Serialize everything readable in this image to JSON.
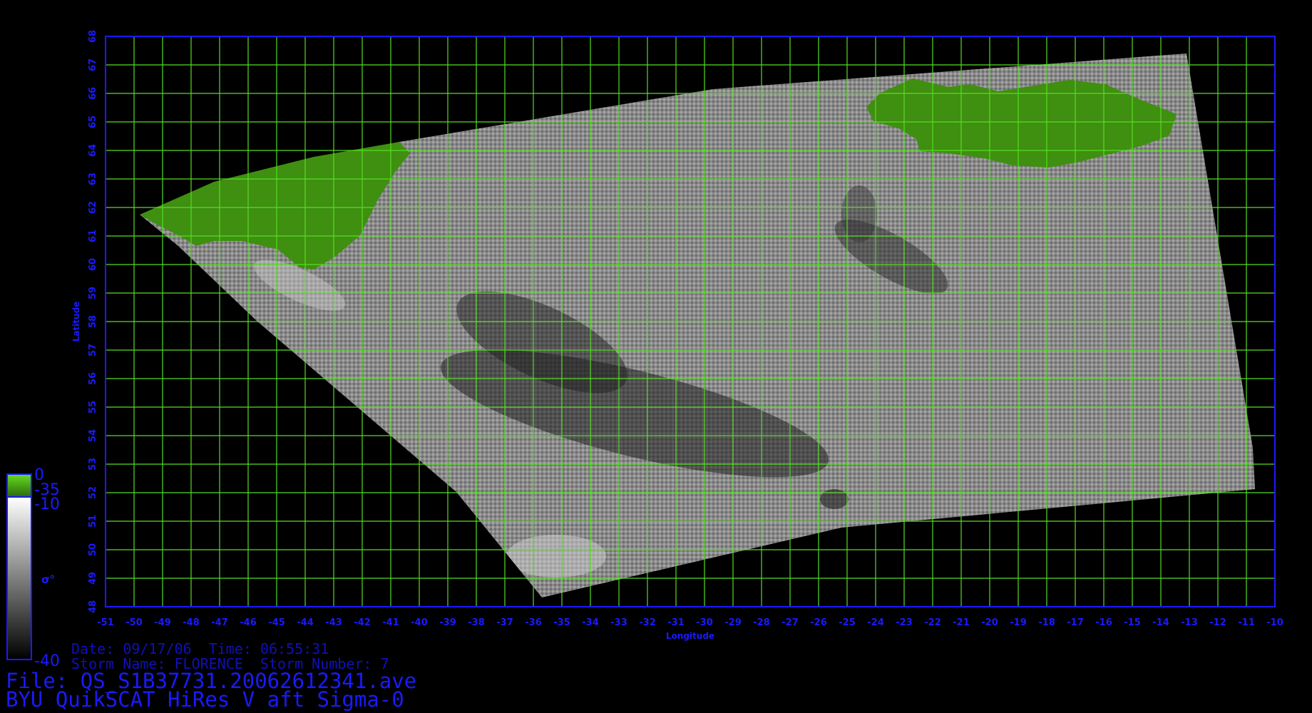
{
  "map": {
    "x_label": "Longitude",
    "y_label": "Latitude",
    "lon_range": [
      -51,
      -10
    ],
    "lat_range": [
      48,
      68
    ],
    "lon_ticks": [
      "-51",
      "-50",
      "-49",
      "-48",
      "-47",
      "-46",
      "-45",
      "-44",
      "-43",
      "-42",
      "-41",
      "-40",
      "-39",
      "-38",
      "-37",
      "-36",
      "-35",
      "-34",
      "-33",
      "-32",
      "-31",
      "-30",
      "-29",
      "-28",
      "-27",
      "-26",
      "-25",
      "-24",
      "-23",
      "-22",
      "-21",
      "-20",
      "-19",
      "-18",
      "-17",
      "-16",
      "-15",
      "-14",
      "-13",
      "-12",
      "-11",
      "-10"
    ],
    "lat_ticks": [
      "48",
      "49",
      "50",
      "51",
      "52",
      "53",
      "54",
      "55",
      "56",
      "57",
      "58",
      "59",
      "60",
      "61",
      "62",
      "63",
      "64",
      "65",
      "66",
      "67",
      "68"
    ],
    "grid_color": "#55dd22",
    "frame_color": "#1a1aff",
    "land_color": "#3f8f10",
    "grid": true
  },
  "colorbar": {
    "land_top": "0",
    "land_bottom": "-35",
    "sigma_top": "-10",
    "sigma_bottom": "-40",
    "symbol": "σ°"
  },
  "info": {
    "date_line": "Date: 09/17/06  Time: 06:55:31",
    "storm_line": "Storm Name: FLORENCE  Storm Number: 7",
    "file_line": "File: QS_S1B37731.20062612341.ave",
    "product_line": "BYU QuikSCAT HiRes V aft Sigma-0"
  }
}
